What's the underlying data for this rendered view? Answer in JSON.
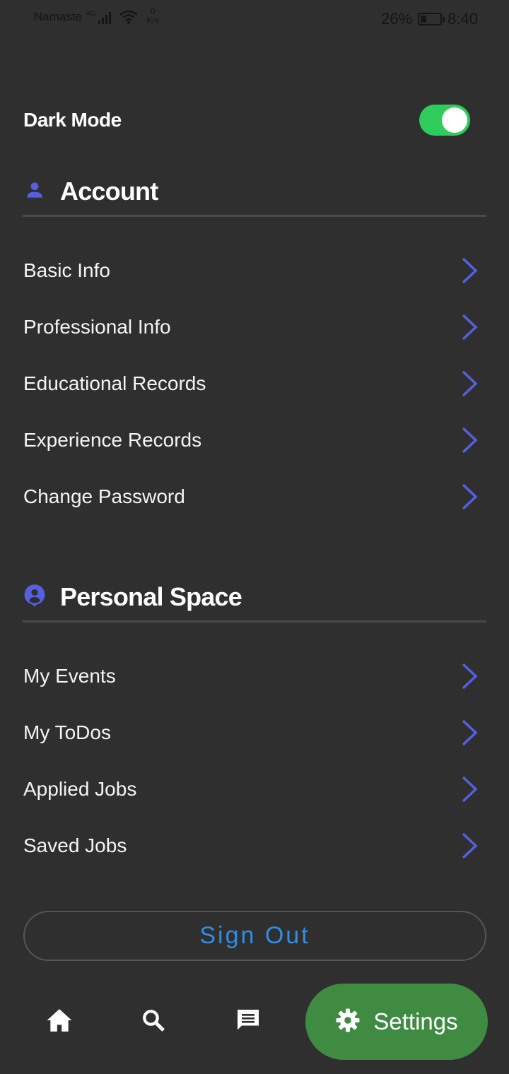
{
  "status_bar": {
    "carrier": "Namaste",
    "network_type": "4G",
    "speed_value": "0",
    "speed_unit": "K/s",
    "battery": "26%",
    "time": "8:40"
  },
  "settings": {
    "dark_mode_label": "Dark Mode",
    "dark_mode_on": true
  },
  "account": {
    "title": "Account",
    "icon": "person-icon",
    "items": [
      {
        "label": "Basic Info"
      },
      {
        "label": "Professional Info"
      },
      {
        "label": "Educational Records"
      },
      {
        "label": "Experience Records"
      },
      {
        "label": "Change Password"
      }
    ]
  },
  "personal_space": {
    "title": "Personal Space",
    "icon": "account-pin-icon",
    "items": [
      {
        "label": "My Events"
      },
      {
        "label": "My ToDos"
      },
      {
        "label": "Applied Jobs"
      },
      {
        "label": "Saved Jobs"
      }
    ]
  },
  "sign_out_label": "Sign Out",
  "bottom_nav": {
    "items": [
      {
        "icon": "home-icon"
      },
      {
        "icon": "search-icon"
      },
      {
        "icon": "chat-icon"
      }
    ],
    "active_label": "Settings",
    "active_icon": "gear-icon"
  },
  "colors": {
    "background": "#2f2f2f",
    "accent_blue": "#5560e0",
    "toggle_green": "#2ecc5a",
    "settings_green": "#3f8b42",
    "sign_out_text": "#2f8de4"
  }
}
